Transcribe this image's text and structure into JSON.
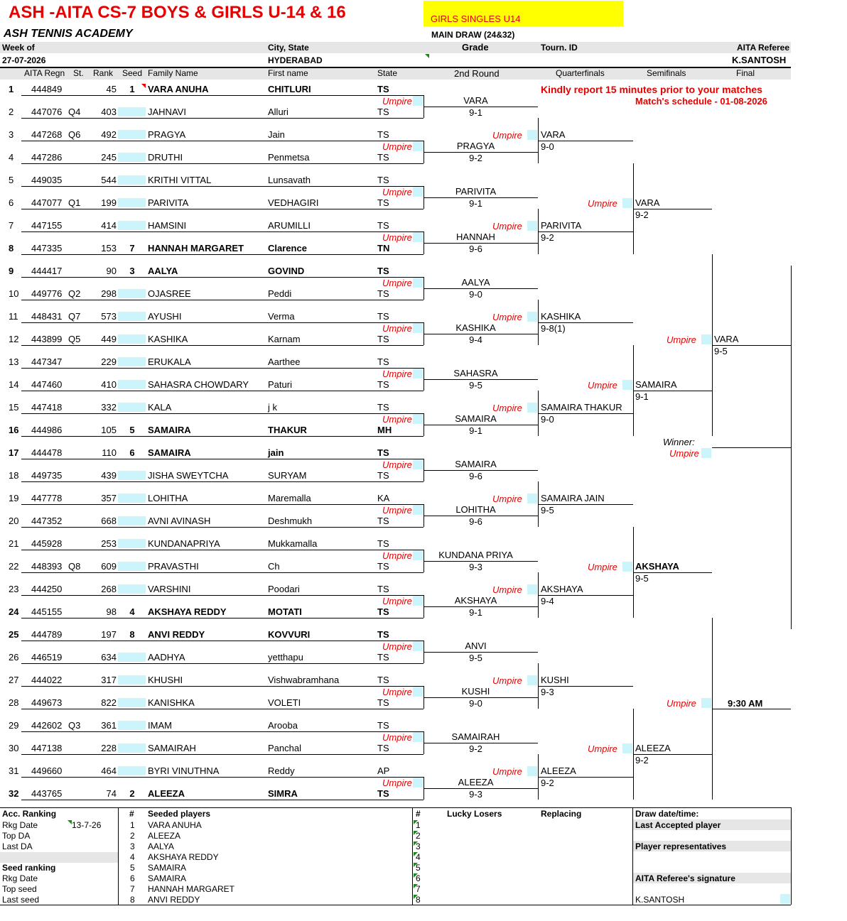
{
  "header": {
    "title": "ASH -AITA CS-7 BOYS & GIRLS U-14 & 16",
    "event": "GIRLS SINGLES U14",
    "academy": "ASH TENNIS ACADEMY",
    "draw": "MAIN DRAW (24&32)",
    "week_label": "Week of",
    "week": "27-07-2026",
    "city_label": "City, State",
    "city": "HYDERABAD",
    "grade_label": "Grade",
    "tourn_label": "Tourn. ID",
    "ref_label": "AITA Referee",
    "referee": "K.SANTOSH"
  },
  "columns": {
    "regn": "AITA Regn",
    "st": "St.",
    "rank": "Rank",
    "seed": "Seed",
    "family": "Family Name",
    "first": "First name",
    "state": "State",
    "r2": "2nd Round",
    "qf": "Quarterfinals",
    "sf": "Semifinals",
    "final": "Final"
  },
  "notice": {
    "line1": "Kindly report 15 minutes prior to your matches",
    "line2": "Match's schedule - 01-08-2026"
  },
  "umpire": "Umpire",
  "players": [
    {
      "n": "1",
      "regn": "444849",
      "st": "",
      "rank": "45",
      "seed": "1",
      "family": "VARA ANUHA",
      "first": "CHITLURI",
      "state": "TS",
      "bold": true
    },
    {
      "n": "2",
      "regn": "447076",
      "st": "Q4",
      "rank": "403",
      "seed": "",
      "family": "JAHNAVI",
      "first": "Alluri",
      "state": "TS",
      "bold": false
    },
    {
      "n": "3",
      "regn": "447268",
      "st": "Q6",
      "rank": "492",
      "seed": "",
      "family": "PRAGYA",
      "first": "Jain",
      "state": "TS",
      "bold": false
    },
    {
      "n": "4",
      "regn": "447286",
      "st": "",
      "rank": "245",
      "seed": "",
      "family": "DRUTHI",
      "first": "Penmetsa",
      "state": "TS",
      "bold": false
    },
    {
      "n": "5",
      "regn": "449035",
      "st": "",
      "rank": "544",
      "seed": "",
      "family": "KRITHI VITTAL",
      "first": "Lunsavath",
      "state": "TS",
      "bold": false
    },
    {
      "n": "6",
      "regn": "447077",
      "st": "Q1",
      "rank": "199",
      "seed": "",
      "family": "PARIVITA",
      "first": "VEDHAGIRI",
      "state": "TS",
      "bold": false
    },
    {
      "n": "7",
      "regn": "447155",
      "st": "",
      "rank": "414",
      "seed": "",
      "family": "HAMSINI",
      "first": "ARUMILLI",
      "state": "TS",
      "bold": false
    },
    {
      "n": "8",
      "regn": "447335",
      "st": "",
      "rank": "153",
      "seed": "7",
      "family": "HANNAH MARGARET",
      "first": "Clarence",
      "state": "TN",
      "bold": true
    },
    {
      "n": "9",
      "regn": "444417",
      "st": "",
      "rank": "90",
      "seed": "3",
      "family": "AALYA",
      "first": "GOVIND",
      "state": "TS",
      "bold": true
    },
    {
      "n": "10",
      "regn": "449776",
      "st": "Q2",
      "rank": "298",
      "seed": "",
      "family": "OJASREE",
      "first": "Peddi",
      "state": "TS",
      "bold": false
    },
    {
      "n": "11",
      "regn": "448431",
      "st": "Q7",
      "rank": "573",
      "seed": "",
      "family": "AYUSHI",
      "first": "Verma",
      "state": "TS",
      "bold": false
    },
    {
      "n": "12",
      "regn": "443899",
      "st": "Q5",
      "rank": "449",
      "seed": "",
      "family": "KASHIKA",
      "first": "Karnam",
      "state": "TS",
      "bold": false
    },
    {
      "n": "13",
      "regn": "447347",
      "st": "",
      "rank": "229",
      "seed": "",
      "family": "ERUKALA",
      "first": "Aarthee",
      "state": "TS",
      "bold": false
    },
    {
      "n": "14",
      "regn": "447460",
      "st": "",
      "rank": "410",
      "seed": "",
      "family": "SAHASRA CHOWDARY",
      "first": "Paturi",
      "state": "TS",
      "bold": false
    },
    {
      "n": "15",
      "regn": "447418",
      "st": "",
      "rank": "332",
      "seed": "",
      "family": "KALA",
      "first": "j k",
      "state": "TS",
      "bold": false
    },
    {
      "n": "16",
      "regn": "444986",
      "st": "",
      "rank": "105",
      "seed": "5",
      "family": "SAMAIRA",
      "first": "THAKUR",
      "state": "MH",
      "bold": true
    },
    {
      "n": "17",
      "regn": "444478",
      "st": "",
      "rank": "110",
      "seed": "6",
      "family": "SAMAIRA",
      "first": "jain",
      "state": "TS",
      "bold": true
    },
    {
      "n": "18",
      "regn": "449735",
      "st": "",
      "rank": "439",
      "seed": "",
      "family": "JISHA SWEYTCHA",
      "first": "SURYAM",
      "state": "TS",
      "bold": false
    },
    {
      "n": "19",
      "regn": "447778",
      "st": "",
      "rank": "357",
      "seed": "",
      "family": "LOHITHA",
      "first": "Maremalla",
      "state": "KA",
      "bold": false
    },
    {
      "n": "20",
      "regn": "447352",
      "st": "",
      "rank": "668",
      "seed": "",
      "family": "AVNI AVINASH",
      "first": "Deshmukh",
      "state": "TS",
      "bold": false
    },
    {
      "n": "21",
      "regn": "445928",
      "st": "",
      "rank": "253",
      "seed": "",
      "family": "KUNDANAPRIYA",
      "first": "Mukkamalla",
      "state": "TS",
      "bold": false
    },
    {
      "n": "22",
      "regn": "448393",
      "st": "Q8",
      "rank": "609",
      "seed": "",
      "family": "PRAVASTHI",
      "first": "Ch",
      "state": "TS",
      "bold": false
    },
    {
      "n": "23",
      "regn": "444250",
      "st": "",
      "rank": "268",
      "seed": "",
      "family": "VARSHINI",
      "first": "Poodari",
      "state": "TS",
      "bold": false
    },
    {
      "n": "24",
      "regn": "445155",
      "st": "",
      "rank": "98",
      "seed": "4",
      "family": "AKSHAYA REDDY",
      "first": "MOTATI",
      "state": "TS",
      "bold": true
    },
    {
      "n": "25",
      "regn": "444789",
      "st": "",
      "rank": "197",
      "seed": "8",
      "family": "ANVI REDDY",
      "first": "KOVVURI",
      "state": "TS",
      "bold": true
    },
    {
      "n": "26",
      "regn": "446519",
      "st": "",
      "rank": "634",
      "seed": "",
      "family": "AADHYA",
      "first": "yetthapu",
      "state": "TS",
      "bold": false
    },
    {
      "n": "27",
      "regn": "444022",
      "st": "",
      "rank": "317",
      "seed": "",
      "family": "KHUSHI",
      "first": "Vishwabramhana",
      "state": "TS",
      "bold": false
    },
    {
      "n": "28",
      "regn": "449673",
      "st": "",
      "rank": "822",
      "seed": "",
      "family": "KANISHKA",
      "first": "VOLETI",
      "state": "TS",
      "bold": false
    },
    {
      "n": "29",
      "regn": "442602",
      "st": "Q3",
      "rank": "361",
      "seed": "",
      "family": "IMAM",
      "first": "Arooba",
      "state": "TS",
      "bold": false
    },
    {
      "n": "30",
      "regn": "447138",
      "st": "",
      "rank": "228",
      "seed": "",
      "family": "SAMAIRAH",
      "first": "Panchal",
      "state": "TS",
      "bold": false
    },
    {
      "n": "31",
      "regn": "449660",
      "st": "",
      "rank": "464",
      "seed": "",
      "family": "BYRI VINUTHNA",
      "first": "Reddy",
      "state": "AP",
      "bold": false
    },
    {
      "n": "32",
      "regn": "443765",
      "st": "",
      "rank": "74",
      "seed": "2",
      "family": "ALEEZA",
      "first": "SIMRA",
      "state": "TS",
      "bold": true
    }
  ],
  "round2": [
    {
      "name": "VARA",
      "score": "9-1"
    },
    {
      "name": "PRAGYA",
      "score": "9-2"
    },
    {
      "name": "PARIVITA",
      "score": "9-1"
    },
    {
      "name": "HANNAH",
      "score": "9-6"
    },
    {
      "name": "AALYA",
      "score": "9-0"
    },
    {
      "name": "KASHIKA",
      "score": "9-4"
    },
    {
      "name": "SAHASRA",
      "score": "9-5"
    },
    {
      "name": "SAMAIRA",
      "score": "9-1"
    },
    {
      "name": "SAMAIRA",
      "score": "9-6"
    },
    {
      "name": "LOHITHA",
      "score": "9-6"
    },
    {
      "name": "KUNDANA PRIYA",
      "score": "9-3"
    },
    {
      "name": "AKSHAYA",
      "score": "9-1"
    },
    {
      "name": "ANVI",
      "score": "9-5"
    },
    {
      "name": "KUSHI",
      "score": "9-0"
    },
    {
      "name": "SAMAIRAH",
      "score": "9-2"
    },
    {
      "name": "ALEEZA",
      "score": "9-3"
    }
  ],
  "quarterfinals": [
    {
      "name": "VARA",
      "score": "9-0"
    },
    {
      "name": "PARIVITA",
      "score": "9-2"
    },
    {
      "name": "KASHIKA",
      "score": "9-8(1)"
    },
    {
      "name": "SAMAIRA THAKUR",
      "score": "9-0"
    },
    {
      "name": "SAMAIRA JAIN",
      "score": "9-5"
    },
    {
      "name": "AKSHAYA",
      "score": "9-4"
    },
    {
      "name": "KUSHI",
      "score": "9-3"
    },
    {
      "name": "ALEEZA",
      "score": "9-2"
    }
  ],
  "semifinals": [
    {
      "name": "VARA",
      "score": "9-2"
    },
    {
      "name": "SAMAIRA",
      "score": "9-1"
    },
    {
      "name": "AKSHAYA",
      "score": "9-5"
    },
    {
      "name": "ALEEZA",
      "score": "9-2"
    }
  ],
  "finals": [
    {
      "name": "VARA",
      "score": "9-5"
    },
    {
      "name": "",
      "score": "9:30 AM"
    }
  ],
  "winner_label": "Winner:",
  "footer": {
    "acc_ranking": "Acc. Ranking",
    "rkg_date": "Rkg Date",
    "rkg_date_val": "13-7-26",
    "top_da": "Top DA",
    "last_da": "Last DA",
    "seed_ranking": "Seed ranking",
    "rkg_date2": "Rkg Date",
    "top_seed": "Top seed",
    "last_seed": "Last seed",
    "hash": "#",
    "seeded_players": "Seeded players",
    "seeds": [
      "VARA ANUHA",
      "ALEEZA",
      "AALYA",
      "AKSHAYA REDDY",
      "SAMAIRA",
      "SAMAIRA",
      "HANNAH MARGARET",
      "ANVI REDDY"
    ],
    "lucky_losers": "Lucky Losers",
    "replacing": "Replacing",
    "ll_nums": [
      "1",
      "2",
      "3",
      "4",
      "5",
      "6",
      "7",
      "8"
    ],
    "draw_date": "Draw date/time:",
    "last_accepted": "Last Accepted player",
    "player_reps": "Player representatives",
    "signature": "AITA Referee's signature",
    "referee_name": "K.SANTOSH"
  }
}
